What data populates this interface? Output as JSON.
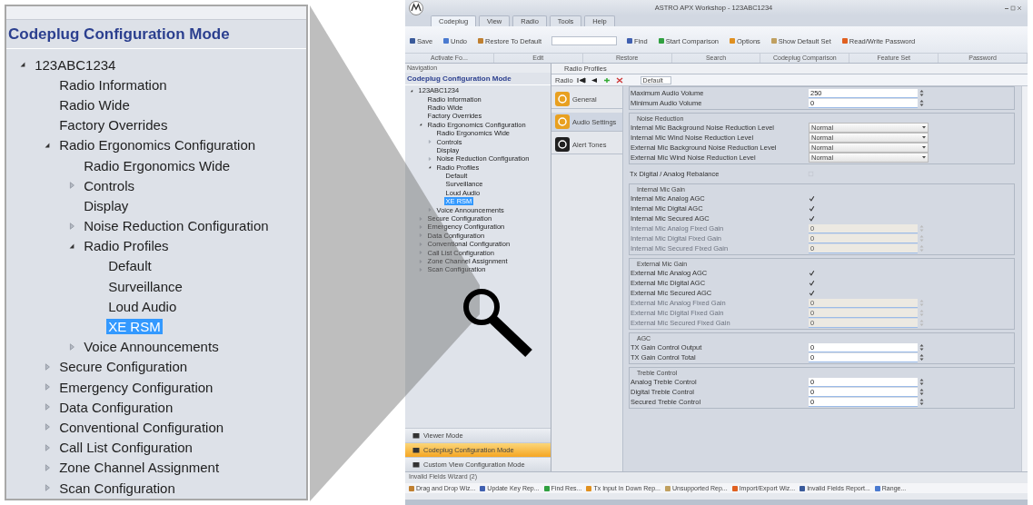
{
  "zoom_panel": {
    "title": "Codeplug Configuration Mode",
    "tree": [
      {
        "label": "123ABC1234",
        "expanded": true,
        "selected": false,
        "children": [
          {
            "label": "Radio Information",
            "selected": false
          },
          {
            "label": "Radio Wide",
            "selected": false
          },
          {
            "label": "Factory Overrides",
            "selected": false
          },
          {
            "label": "Radio Ergonomics Configuration",
            "expanded": true,
            "selected": false,
            "children": [
              {
                "label": "Radio Ergonomics Wide",
                "selected": false
              },
              {
                "label": "Controls",
                "expanded": false,
                "selected": false
              },
              {
                "label": "Display",
                "selected": false
              },
              {
                "label": "Noise Reduction Configuration",
                "expanded": false,
                "selected": false
              },
              {
                "label": "Radio Profiles",
                "expanded": true,
                "selected": false,
                "children": [
                  {
                    "label": "Default",
                    "selected": false
                  },
                  {
                    "label": "Surveillance",
                    "selected": false
                  },
                  {
                    "label": "Loud Audio",
                    "selected": false
                  },
                  {
                    "label": "XE RSM",
                    "selected": true
                  }
                ]
              },
              {
                "label": "Voice Announcements",
                "expanded": false,
                "selected": false
              }
            ]
          },
          {
            "label": "Secure Configuration",
            "expanded": false,
            "selected": false
          },
          {
            "label": "Emergency Configuration",
            "expanded": false,
            "selected": false
          },
          {
            "label": "Data Configuration",
            "expanded": false,
            "selected": false
          },
          {
            "label": "Conventional Configuration",
            "expanded": false,
            "selected": false
          },
          {
            "label": "Call List Configuration",
            "expanded": false,
            "selected": false
          },
          {
            "label": "Zone Channel Assignment",
            "expanded": false,
            "selected": false
          },
          {
            "label": "Scan Configuration",
            "expanded": false,
            "selected": false
          }
        ]
      }
    ]
  },
  "window": {
    "title": "ASTRO APX Workshop - 123ABC1234",
    "tabs": [
      {
        "label": "Codeplug",
        "selected": true
      },
      {
        "label": "View",
        "selected": false
      },
      {
        "label": "Radio",
        "selected": false
      },
      {
        "label": "Tools",
        "selected": false
      },
      {
        "label": "Help",
        "selected": false
      }
    ],
    "ribbon_buttons": [
      {
        "label": "Save"
      },
      {
        "label": "Undo"
      },
      {
        "label": "Restore To Default"
      },
      {
        "label": "Find"
      },
      {
        "label": "Start Comparison"
      },
      {
        "label": "Options"
      },
      {
        "label": "Show Default Set"
      },
      {
        "label": "Read/Write Password"
      }
    ],
    "ribbon_groups": [
      "Activate Fo...",
      "Edit",
      "Restore",
      "Search",
      "Codeplug Comparison",
      "Feature Set",
      "Password"
    ],
    "navigation": {
      "title": "Navigation",
      "heading": "Codeplug Configuration Mode",
      "tree": [
        {
          "label": "123ABC1234",
          "expanded": true,
          "selected": false,
          "children": [
            {
              "label": "Radio Information",
              "selected": false
            },
            {
              "label": "Radio Wide",
              "selected": false
            },
            {
              "label": "Factory Overrides",
              "selected": false
            },
            {
              "label": "Radio Ergonomics Configuration",
              "expanded": true,
              "selected": false,
              "children": [
                {
                  "label": "Radio Ergonomics Wide",
                  "selected": false
                },
                {
                  "label": "Controls",
                  "expanded": false,
                  "selected": false
                },
                {
                  "label": "Display",
                  "selected": false
                },
                {
                  "label": "Noise Reduction Configuration",
                  "expanded": false,
                  "selected": false
                },
                {
                  "label": "Radio Profiles",
                  "expanded": true,
                  "selected": false,
                  "children": [
                    {
                      "label": "Default",
                      "selected": false
                    },
                    {
                      "label": "Surveillance",
                      "selected": false
                    },
                    {
                      "label": "Loud Audio",
                      "selected": false
                    },
                    {
                      "label": "XE RSM",
                      "selected": true
                    }
                  ]
                },
                {
                  "label": "Voice Announcements",
                  "expanded": false,
                  "selected": false
                }
              ]
            },
            {
              "label": "Secure Configuration",
              "expanded": false,
              "selected": false
            },
            {
              "label": "Emergency Configuration",
              "expanded": false,
              "selected": false
            },
            {
              "label": "Data Configuration",
              "expanded": false,
              "selected": false
            },
            {
              "label": "Conventional Configuration",
              "expanded": false,
              "selected": false
            },
            {
              "label": "Call List Configuration",
              "expanded": false,
              "selected": false
            },
            {
              "label": "Zone Channel Assignment",
              "expanded": false,
              "selected": false
            },
            {
              "label": "Scan Configuration",
              "expanded": false,
              "selected": false
            }
          ]
        }
      ],
      "modes": [
        {
          "label": "Viewer Mode",
          "selected": false
        },
        {
          "label": "Codeplug Configuration Mode",
          "selected": true
        },
        {
          "label": "Custom View Configuration Mode",
          "selected": false
        }
      ]
    },
    "document": {
      "tab": "Radio Profiles",
      "toolbar_label": "Radio",
      "toolbar_select": "Default",
      "profiles": [
        {
          "label": "General",
          "selected": false,
          "color": "#e8a020"
        },
        {
          "label": "Audio Settings",
          "selected": true,
          "color": "#e8a020"
        },
        {
          "label": "Alert Tones",
          "selected": false,
          "color": "#202020"
        }
      ],
      "sections": [
        {
          "kind": "group",
          "rows": [
            {
              "kind": "spin",
              "label": "Maximum Audio Volume",
              "value": "250",
              "disabled": false
            },
            {
              "kind": "spin",
              "label": "Minimum Audio Volume",
              "value": "0",
              "disabled": false
            }
          ]
        },
        {
          "kind": "group",
          "title": "Noise Reduction",
          "rows": [
            {
              "kind": "select",
              "label": "Internal Mic Background Noise Reduction Level",
              "value": "Normal",
              "disabled": false
            },
            {
              "kind": "select",
              "label": "Internal Mic Wind Noise Reduction Level",
              "value": "Normal",
              "disabled": false
            },
            {
              "kind": "select",
              "label": "External Mic Background Noise Reduction Level",
              "value": "Normal",
              "disabled": false
            },
            {
              "kind": "select",
              "label": "External Mic Wind Noise Reduction Level",
              "value": "Normal",
              "disabled": false
            }
          ]
        },
        {
          "kind": "plain",
          "rows": [
            {
              "kind": "check",
              "label": "Tx Digital / Analog Rebalance",
              "checked": false,
              "disabled": false
            }
          ]
        },
        {
          "kind": "group",
          "title": "Internal Mic Gain",
          "rows": [
            {
              "kind": "check",
              "label": "Internal Mic Analog AGC",
              "checked": true,
              "disabled": false
            },
            {
              "kind": "check",
              "label": "Internal Mic Digital AGC",
              "checked": true,
              "disabled": false
            },
            {
              "kind": "check",
              "label": "Internal Mic Secured AGC",
              "checked": true,
              "disabled": false
            },
            {
              "kind": "spin",
              "label": "Internal Mic Analog Fixed Gain",
              "value": "0",
              "disabled": true
            },
            {
              "kind": "spin",
              "label": "Internal Mic Digital Fixed Gain",
              "value": "0",
              "disabled": true
            },
            {
              "kind": "spin",
              "label": "Internal Mic Secured Fixed Gain",
              "value": "0",
              "disabled": true
            }
          ]
        },
        {
          "kind": "group",
          "title": "External Mic Gain",
          "rows": [
            {
              "kind": "check",
              "label": "External Mic Analog AGC",
              "checked": true,
              "disabled": false
            },
            {
              "kind": "check",
              "label": "External Mic Digital AGC",
              "checked": true,
              "disabled": false
            },
            {
              "kind": "check",
              "label": "External Mic Secured AGC",
              "checked": true,
              "disabled": false
            },
            {
              "kind": "spin",
              "label": "External Mic Analog Fixed Gain",
              "value": "0",
              "disabled": true
            },
            {
              "kind": "spin",
              "label": "External Mic Digital Fixed Gain",
              "value": "0",
              "disabled": true
            },
            {
              "kind": "spin",
              "label": "External Mic Secured Fixed Gain",
              "value": "0",
              "disabled": true
            }
          ]
        },
        {
          "kind": "group",
          "title": "AGC",
          "rows": [
            {
              "kind": "spin",
              "label": "TX Gain Control Output",
              "value": "0",
              "disabled": false
            },
            {
              "kind": "spin",
              "label": "TX Gain Control Total",
              "value": "0",
              "disabled": false
            }
          ]
        },
        {
          "kind": "group",
          "title": "Treble Control",
          "rows": [
            {
              "kind": "spin",
              "label": "Analog Treble Control",
              "value": "0",
              "disabled": false
            },
            {
              "kind": "spin",
              "label": "Digital Treble Control",
              "value": "0",
              "disabled": false
            },
            {
              "kind": "spin",
              "label": "Secured Treble Control",
              "value": "0",
              "disabled": false
            }
          ]
        }
      ]
    },
    "bottom_panel": {
      "title": "Invalid Fields Wizard (2)",
      "items": [
        "Drag and Drop Wiz...",
        "Update Key Rep...",
        "Find Res...",
        "Tx Input In Down Rep...",
        "Unsupported Rep...",
        "Import/Export Wiz...",
        "Invalid Fields Report...",
        "Range..."
      ]
    }
  }
}
